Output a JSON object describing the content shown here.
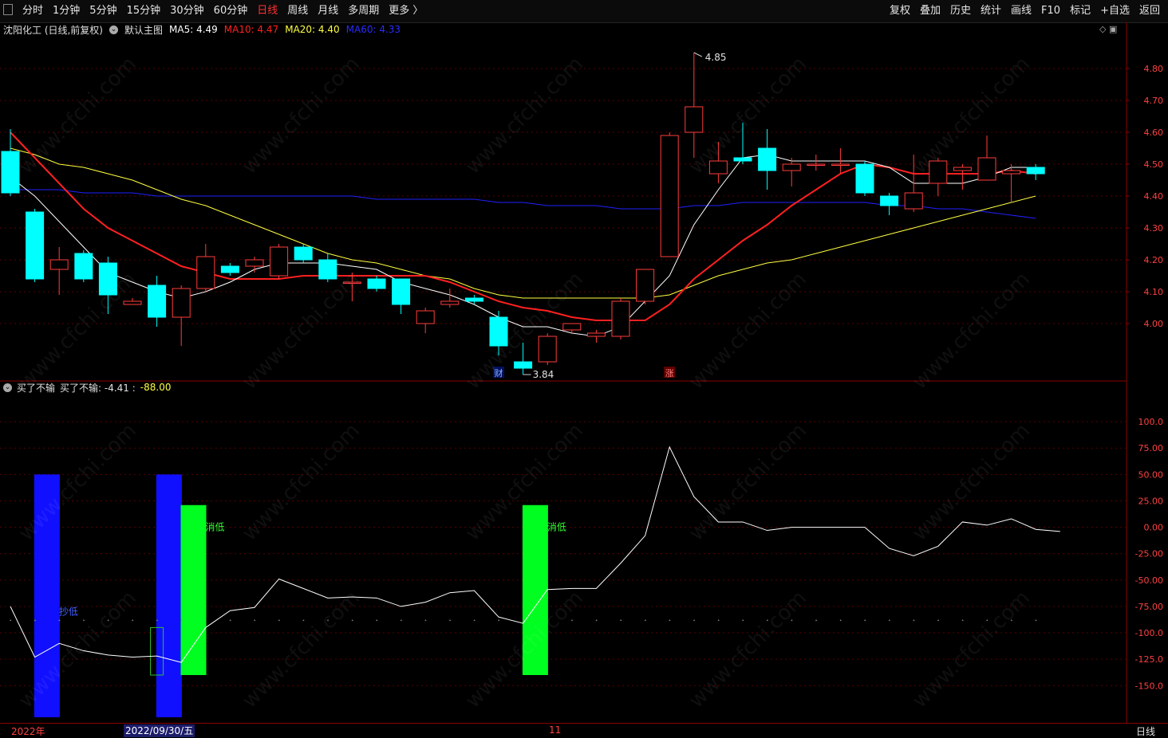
{
  "toolbar": {
    "periods": [
      "分时",
      "1分钟",
      "5分钟",
      "15分钟",
      "30分钟",
      "60分钟",
      "日线",
      "周线",
      "月线",
      "多周期",
      "更多 〉"
    ],
    "active_period": "日线",
    "tools": [
      "复权",
      "叠加",
      "历史",
      "统计",
      "画线",
      "F10",
      "标记",
      "+自选",
      "返回"
    ]
  },
  "main": {
    "title": "沈阳化工 (日线,前复权)",
    "template": "默认主图",
    "ma5": "MA5: 4.49",
    "ma10": "MA10: 4.47",
    "ma20": "MA20: 4.40",
    "ma60": "MA60: 4.33",
    "high_label": "4.85",
    "low_label": "3.84",
    "marker_cai": "财",
    "marker_zhang": "涨",
    "y_ticks": [
      "4.80",
      "4.70",
      "4.60",
      "4.50",
      "4.40",
      "4.30",
      "4.20",
      "4.10",
      "4.00"
    ]
  },
  "sub": {
    "name": "买了不输",
    "formula": "买了不输: -4.41 :",
    "value": "-88.00",
    "y_ticks": [
      "100.0",
      "75.00",
      "50.00",
      "25.00",
      "0.00",
      "-25.00",
      "-50.00",
      "-75.00",
      "-100.0",
      "-125.0",
      "-150.0"
    ],
    "bar_labels": [
      "抄低",
      "抄低",
      "消低",
      "消低"
    ]
  },
  "bottom": {
    "year_label": "2022年",
    "cursor_date": "2022/09/30/五",
    "month_label": "11",
    "period_label": "日线"
  },
  "colors": {
    "up": "#ff3b3b",
    "down": "#00ffff",
    "ma5": "#ffffff",
    "ma10": "#ff2020",
    "ma20": "#ffff40",
    "ma60": "#2020ff"
  },
  "watermark": "www.cfchi.com",
  "chart_data": {
    "type": "candlestick",
    "candles": [
      {
        "o": 4.54,
        "c": 4.41,
        "h": 4.61,
        "l": 4.4
      },
      {
        "o": 4.35,
        "c": 4.14,
        "h": 4.36,
        "l": 4.13
      },
      {
        "o": 4.17,
        "c": 4.2,
        "h": 4.24,
        "l": 4.09
      },
      {
        "o": 4.22,
        "c": 4.14,
        "h": 4.23,
        "l": 4.13
      },
      {
        "o": 4.19,
        "c": 4.09,
        "h": 4.21,
        "l": 4.03
      },
      {
        "o": 4.06,
        "c": 4.07,
        "h": 4.08,
        "l": 4.06
      },
      {
        "o": 4.12,
        "c": 4.02,
        "h": 4.15,
        "l": 3.99
      },
      {
        "o": 4.02,
        "c": 4.11,
        "h": 4.12,
        "l": 3.93
      },
      {
        "o": 4.11,
        "c": 4.21,
        "h": 4.25,
        "l": 4.1
      },
      {
        "o": 4.18,
        "c": 4.16,
        "h": 4.19,
        "l": 4.15
      },
      {
        "o": 4.18,
        "c": 4.2,
        "h": 4.21,
        "l": 4.16
      },
      {
        "o": 4.15,
        "c": 4.24,
        "h": 4.25,
        "l": 4.14
      },
      {
        "o": 4.24,
        "c": 4.2,
        "h": 4.25,
        "l": 4.19
      },
      {
        "o": 4.2,
        "c": 4.14,
        "h": 4.22,
        "l": 4.13
      },
      {
        "o": 4.13,
        "c": 4.13,
        "h": 4.16,
        "l": 4.07
      },
      {
        "o": 4.14,
        "c": 4.11,
        "h": 4.15,
        "l": 4.1
      },
      {
        "o": 4.14,
        "c": 4.06,
        "h": 4.14,
        "l": 4.03
      },
      {
        "o": 4.0,
        "c": 4.04,
        "h": 4.05,
        "l": 3.97
      },
      {
        "o": 4.06,
        "c": 4.07,
        "h": 4.11,
        "l": 4.05
      },
      {
        "o": 4.08,
        "c": 4.07,
        "h": 4.09,
        "l": 4.06
      },
      {
        "o": 4.02,
        "c": 3.93,
        "h": 4.04,
        "l": 3.9
      },
      {
        "o": 3.88,
        "c": 3.86,
        "h": 3.94,
        "l": 3.84
      },
      {
        "o": 3.88,
        "c": 3.96,
        "h": 3.97,
        "l": 3.87
      },
      {
        "o": 3.98,
        "c": 4.0,
        "h": 4.0,
        "l": 3.97
      },
      {
        "o": 3.96,
        "c": 3.97,
        "h": 3.98,
        "l": 3.94
      },
      {
        "o": 3.96,
        "c": 4.07,
        "h": 4.08,
        "l": 3.95
      },
      {
        "o": 4.07,
        "c": 4.17,
        "h": 4.17,
        "l": 4.06
      },
      {
        "o": 4.21,
        "c": 4.59,
        "h": 4.6,
        "l": 4.21
      },
      {
        "o": 4.6,
        "c": 4.68,
        "h": 4.85,
        "l": 4.52
      },
      {
        "o": 4.47,
        "c": 4.51,
        "h": 4.57,
        "l": 4.44
      },
      {
        "o": 4.52,
        "c": 4.51,
        "h": 4.63,
        "l": 4.5
      },
      {
        "o": 4.55,
        "c": 4.48,
        "h": 4.61,
        "l": 4.42
      },
      {
        "o": 4.48,
        "c": 4.5,
        "h": 4.52,
        "l": 4.43
      },
      {
        "o": 4.5,
        "c": 4.5,
        "h": 4.53,
        "l": 4.48
      },
      {
        "o": 4.5,
        "c": 4.5,
        "h": 4.55,
        "l": 4.47
      },
      {
        "o": 4.5,
        "c": 4.41,
        "h": 4.51,
        "l": 4.4
      },
      {
        "o": 4.4,
        "c": 4.37,
        "h": 4.41,
        "l": 4.34
      },
      {
        "o": 4.36,
        "c": 4.41,
        "h": 4.53,
        "l": 4.35
      },
      {
        "o": 4.44,
        "c": 4.51,
        "h": 4.52,
        "l": 4.4
      },
      {
        "o": 4.48,
        "c": 4.49,
        "h": 4.5,
        "l": 4.42
      },
      {
        "o": 4.45,
        "c": 4.52,
        "h": 4.59,
        "l": 4.45
      },
      {
        "o": 4.47,
        "c": 4.48,
        "h": 4.5,
        "l": 4.38
      },
      {
        "o": 4.49,
        "c": 4.47,
        "h": 4.5,
        "l": 4.45
      }
    ],
    "ma5": [
      4.46,
      4.4,
      4.32,
      4.24,
      4.16,
      4.13,
      4.1,
      4.08,
      4.1,
      4.13,
      4.17,
      4.19,
      4.19,
      4.19,
      4.18,
      4.17,
      4.13,
      4.11,
      4.09,
      4.06,
      4.02,
      3.99,
      3.99,
      3.97,
      3.96,
      3.99,
      4.07,
      4.15,
      4.31,
      4.42,
      4.52,
      4.53,
      4.51,
      4.51,
      4.51,
      4.51,
      4.49,
      4.44,
      4.44,
      4.44,
      4.46,
      4.49,
      4.49
    ],
    "ma10": [
      4.6,
      4.52,
      4.44,
      4.36,
      4.3,
      4.26,
      4.22,
      4.18,
      4.16,
      4.14,
      4.14,
      4.14,
      4.15,
      4.15,
      4.15,
      4.15,
      4.15,
      4.15,
      4.13,
      4.1,
      4.07,
      4.05,
      4.04,
      4.02,
      4.01,
      4.01,
      4.01,
      4.06,
      4.14,
      4.2,
      4.26,
      4.31,
      4.37,
      4.42,
      4.47,
      4.5,
      4.49,
      4.47,
      4.47,
      4.47,
      4.47,
      4.48,
      4.47
    ],
    "ma20": [
      4.55,
      4.53,
      4.5,
      4.49,
      4.47,
      4.45,
      4.42,
      4.39,
      4.37,
      4.34,
      4.31,
      4.28,
      4.25,
      4.22,
      4.2,
      4.19,
      4.17,
      4.15,
      4.14,
      4.11,
      4.09,
      4.08,
      4.08,
      4.08,
      4.08,
      4.08,
      4.08,
      4.09,
      4.12,
      4.15,
      4.17,
      4.19,
      4.2,
      4.22,
      4.24,
      4.26,
      4.28,
      4.3,
      4.32,
      4.34,
      4.36,
      4.38,
      4.4
    ],
    "ma60": [
      4.42,
      4.42,
      4.42,
      4.41,
      4.41,
      4.41,
      4.4,
      4.4,
      4.4,
      4.4,
      4.4,
      4.4,
      4.4,
      4.4,
      4.4,
      4.39,
      4.39,
      4.39,
      4.39,
      4.39,
      4.38,
      4.38,
      4.37,
      4.37,
      4.37,
      4.36,
      4.36,
      4.36,
      4.37,
      4.37,
      4.38,
      4.38,
      4.38,
      4.38,
      4.38,
      4.38,
      4.37,
      4.37,
      4.36,
      4.36,
      4.35,
      4.34,
      4.33
    ],
    "indicator": [
      -75,
      -123,
      -110,
      -117,
      -121,
      -123,
      -122,
      -128,
      -95,
      -79,
      -76,
      -49,
      -58,
      -67,
      -66,
      -67,
      -75,
      -71,
      -62,
      -60,
      -85,
      -91,
      -59,
      -58,
      -58,
      -34,
      -8,
      76,
      29,
      5,
      5,
      -3,
      0,
      0,
      0,
      0,
      -20,
      -27,
      -18,
      5,
      2,
      8,
      -2,
      -4
    ],
    "indicator_ylim": [
      -180,
      125
    ],
    "ylim": [
      3.83,
      4.9
    ],
    "signal_bars": [
      {
        "i": 1.5,
        "from": 50,
        "to": -180,
        "color": "#1010ff",
        "label_i": 0
      },
      {
        "i": 6.5,
        "from": 50,
        "to": -180,
        "color": "#1010ff",
        "label_i": 1
      },
      {
        "i": 7.5,
        "from": 21,
        "to": -140,
        "color": "#00ff20",
        "label_i": 2
      },
      {
        "i": 21.5,
        "from": 21,
        "to": -140,
        "color": "#00ff20",
        "label_i": 3
      }
    ],
    "hollow_box": {
      "i": 6,
      "from": -95,
      "to": -140
    }
  }
}
